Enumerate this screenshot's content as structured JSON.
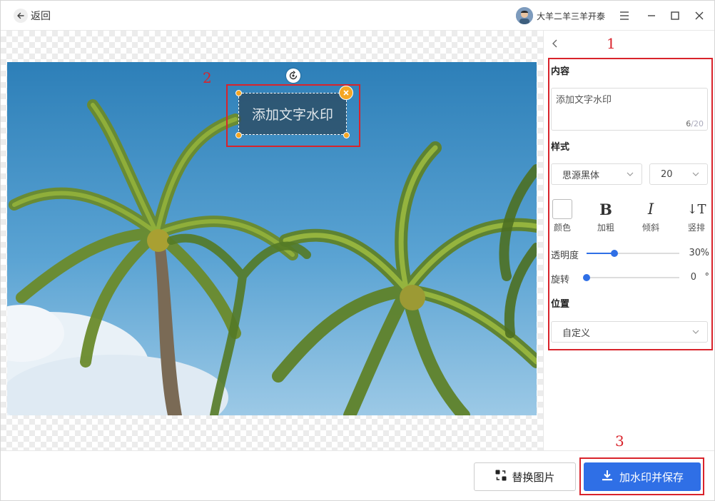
{
  "topbar": {
    "back_label": "返回",
    "username": "大羊二羊三羊开泰",
    "icons": [
      "back-arrow-icon",
      "menu-icon",
      "minimize-icon",
      "maximize-icon",
      "close-icon"
    ]
  },
  "canvas": {
    "watermark_text": "添加文字水印",
    "close_icon": "×"
  },
  "annotations": {
    "one": "1",
    "two": "2",
    "three": "3",
    "color": "#d9232b"
  },
  "panel": {
    "content_title": "内容",
    "content_value": "添加文字水印",
    "char_count": "6",
    "char_max": "/20",
    "style_title": "样式",
    "font_family": "思源黑体",
    "font_size": "20",
    "format": {
      "color_label": "颜色",
      "bold_glyph": "B",
      "bold_label": "加粗",
      "italic_glyph": "I",
      "italic_label": "倾斜",
      "vertical_glyph": "↓T",
      "vertical_label": "竖排"
    },
    "opacity_label": "透明度",
    "opacity_value": "30",
    "opacity_unit": "%",
    "opacity_fraction": 0.3,
    "rotate_label": "旋转",
    "rotate_value": "0",
    "rotate_unit": "°",
    "rotate_fraction": 0.0,
    "position_title": "位置",
    "position_value": "自定义"
  },
  "bottombar": {
    "replace_label": "替换图片",
    "save_label": "加水印并保存"
  },
  "colors": {
    "accent": "#2f6fe6",
    "handle": "#f5a623"
  }
}
